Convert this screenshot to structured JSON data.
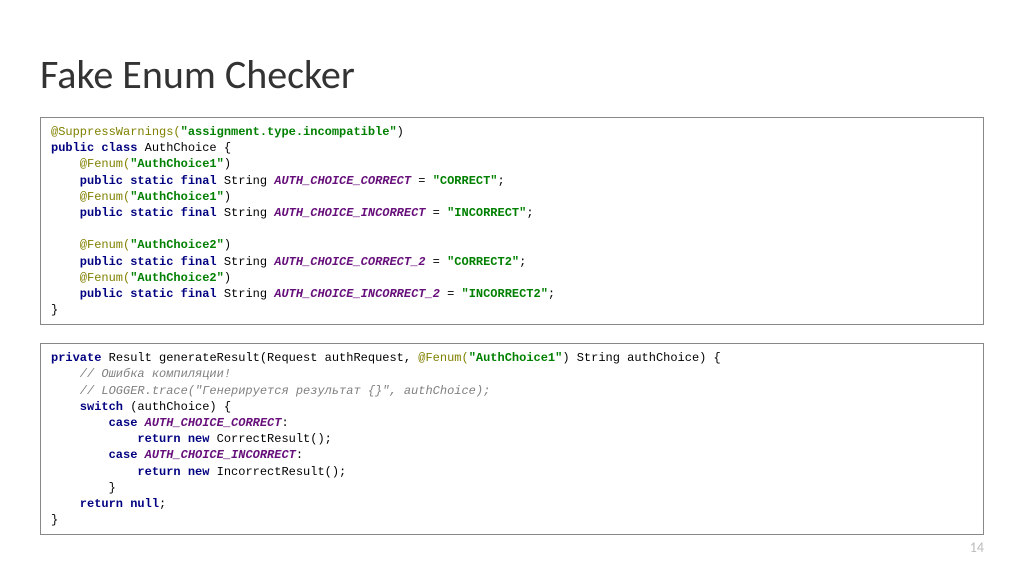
{
  "title": "Fake Enum Checker",
  "page_number": "14",
  "code1": {
    "l1a": "@SuppressWarnings(",
    "l1b": "\"assignment.type.incompatible\"",
    "l1c": ")",
    "l2a": "public class",
    "l2b": " AuthChoice {",
    "l3a": "    @Fenum(",
    "l3b": "\"AuthChoice1\"",
    "l3c": ")",
    "l4a": "    public static final",
    "l4b": " String ",
    "l4c": "AUTH_CHOICE_CORRECT",
    "l4d": " = ",
    "l4e": "\"CORRECT\"",
    "l4f": ";",
    "l5a": "    @Fenum(",
    "l5b": "\"AuthChoice1\"",
    "l5c": ")",
    "l6a": "    public static final",
    "l6b": " String ",
    "l6c": "AUTH_CHOICE_INCORRECT",
    "l6d": " = ",
    "l6e": "\"INCORRECT\"",
    "l6f": ";",
    "blank1": "",
    "l7a": "    @Fenum(",
    "l7b": "\"AuthChoice2\"",
    "l7c": ")",
    "l8a": "    public static final",
    "l8b": " String ",
    "l8c": "AUTH_CHOICE_CORRECT_2",
    "l8d": " = ",
    "l8e": "\"CORRECT2\"",
    "l8f": ";",
    "l9a": "    @Fenum(",
    "l9b": "\"AuthChoice2\"",
    "l9c": ")",
    "l10a": "    public static final",
    "l10b": " String ",
    "l10c": "AUTH_CHOICE_INCORRECT_2",
    "l10d": " = ",
    "l10e": "\"INCORRECT2\"",
    "l10f": ";",
    "l11": "}"
  },
  "code2": {
    "l1a": "private",
    "l1b": " Result generateResult(Request authRequest, ",
    "l1c": "@Fenum(",
    "l1d": "\"AuthChoice1\"",
    "l1e": ")",
    "l1f": " String authChoice) {",
    "l2": "    // Ошибка компиляции!",
    "l3": "    // LOGGER.trace(\"Генерируется результат {}\", authChoice);",
    "l4a": "    switch",
    "l4b": " (authChoice) {",
    "l5a": "        case ",
    "l5b": "AUTH_CHOICE_CORRECT",
    "l5c": ":",
    "l6a": "            return new",
    "l6b": " CorrectResult();",
    "l7a": "        case ",
    "l7b": "AUTH_CHOICE_INCORRECT",
    "l7c": ":",
    "l8a": "            return new",
    "l8b": " IncorrectResult();",
    "l9": "        }",
    "l10a": "    return null",
    "l10b": ";",
    "l11": "}"
  }
}
